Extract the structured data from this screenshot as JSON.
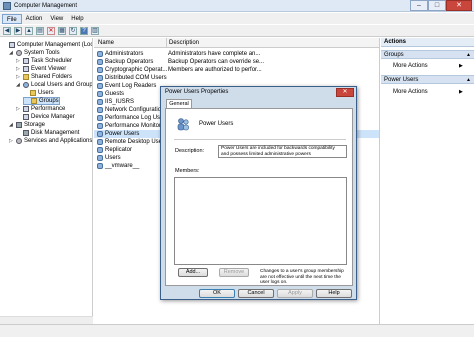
{
  "window": {
    "title": "Computer Management",
    "min": "–",
    "max": "□",
    "close": "✕"
  },
  "menu": [
    "File",
    "Action",
    "View",
    "Help"
  ],
  "tree": [
    {
      "label": "Computer Management (Local",
      "indent": 0,
      "icon": "computer-icon",
      "exp": ""
    },
    {
      "label": "System Tools",
      "indent": 1,
      "icon": "tools-icon",
      "exp": "◢"
    },
    {
      "label": "Task Scheduler",
      "indent": 2,
      "icon": "clock-icon",
      "exp": "▷"
    },
    {
      "label": "Event Viewer",
      "indent": 2,
      "icon": "event-icon",
      "exp": "▷"
    },
    {
      "label": "Shared Folders",
      "indent": 2,
      "icon": "folder-icon",
      "exp": "▷"
    },
    {
      "label": "Local Users and Groups",
      "indent": 2,
      "icon": "users-icon",
      "exp": "◢"
    },
    {
      "label": "Users",
      "indent": 3,
      "icon": "folder-icon",
      "exp": ""
    },
    {
      "label": "Groups",
      "indent": 3,
      "icon": "folder-icon",
      "exp": "",
      "selected": true
    },
    {
      "label": "Performance",
      "indent": 2,
      "icon": "performance-icon",
      "exp": "▷"
    },
    {
      "label": "Device Manager",
      "indent": 2,
      "icon": "device-icon",
      "exp": ""
    },
    {
      "label": "Storage",
      "indent": 1,
      "icon": "storage-icon",
      "exp": "◢"
    },
    {
      "label": "Disk Management",
      "indent": 2,
      "icon": "disk-icon",
      "exp": ""
    },
    {
      "label": "Services and Applications",
      "indent": 1,
      "icon": "services-icon",
      "exp": "▷"
    }
  ],
  "list": {
    "columns": [
      "Name",
      "Description"
    ],
    "rows": [
      {
        "name": "Administrators",
        "desc": "Administrators have complete an..."
      },
      {
        "name": "Backup Operators",
        "desc": "Backup Operators can override se..."
      },
      {
        "name": "Cryptographic Operat...",
        "desc": "Members are authorized to perfor..."
      },
      {
        "name": "Distributed COM Users",
        "desc": ""
      },
      {
        "name": "Event Log Readers",
        "desc": ""
      },
      {
        "name": "Guests",
        "desc": ""
      },
      {
        "name": "IIS_IUSRS",
        "desc": ""
      },
      {
        "name": "Network Configuratio...",
        "desc": ""
      },
      {
        "name": "Performance Log Users",
        "desc": ""
      },
      {
        "name": "Performance Monitor ...",
        "desc": ""
      },
      {
        "name": "Power Users",
        "desc": "",
        "selected": true
      },
      {
        "name": "Remote Desktop Users",
        "desc": ""
      },
      {
        "name": "Replicator",
        "desc": ""
      },
      {
        "name": "Users",
        "desc": ""
      },
      {
        "name": "__vmware__",
        "desc": ""
      }
    ]
  },
  "actions": {
    "header": "Actions",
    "sections": [
      {
        "title": "Groups",
        "item": "More Actions"
      },
      {
        "title": "Power Users",
        "item": "More Actions"
      }
    ]
  },
  "dialog": {
    "title": "Power Users Properties",
    "tab": "General",
    "group_name": "Power Users",
    "description_label": "Description:",
    "description_value": "Power Users are included for backwards compatibility and possess limited administrative powers",
    "members_label": "Members:",
    "add_label": "Add...",
    "remove_label": "Remove",
    "note": "Changes to a user's group membership are not effective until the next time the user logs on.",
    "ok_label": "OK",
    "cancel_label": "Cancel",
    "apply_label": "Apply",
    "help_label": "Help"
  }
}
